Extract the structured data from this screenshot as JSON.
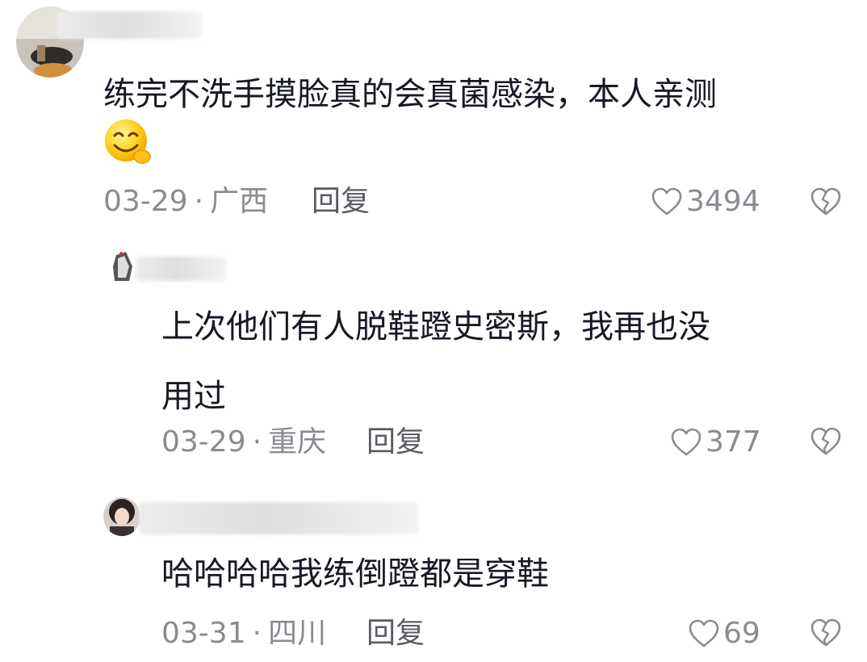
{
  "comments": [
    {
      "text": "练完不洗手摸脸真的会真菌感染，本人亲测",
      "emoji": "smiling-face-emoji",
      "date": "03-29",
      "separator": "·",
      "location": "广西",
      "reply_label": "回复",
      "likes": "3494"
    },
    {
      "text": "上次他们有人脱鞋蹬史密斯，我再也没\n用过",
      "date": "03-29",
      "separator": "·",
      "location": "重庆",
      "reply_label": "回复",
      "likes": "377"
    },
    {
      "text": "哈哈哈哈我练倒蹬都是穿鞋",
      "date": "03-31",
      "separator": "·",
      "location": "四川",
      "reply_label": "回复",
      "likes": "69"
    }
  ],
  "icons": {
    "like": "heart-outline-icon",
    "dislike": "broken-heart-icon"
  },
  "colors": {
    "text": "#161823",
    "meta": "#8a8b91",
    "reply": "#5a5b63"
  }
}
